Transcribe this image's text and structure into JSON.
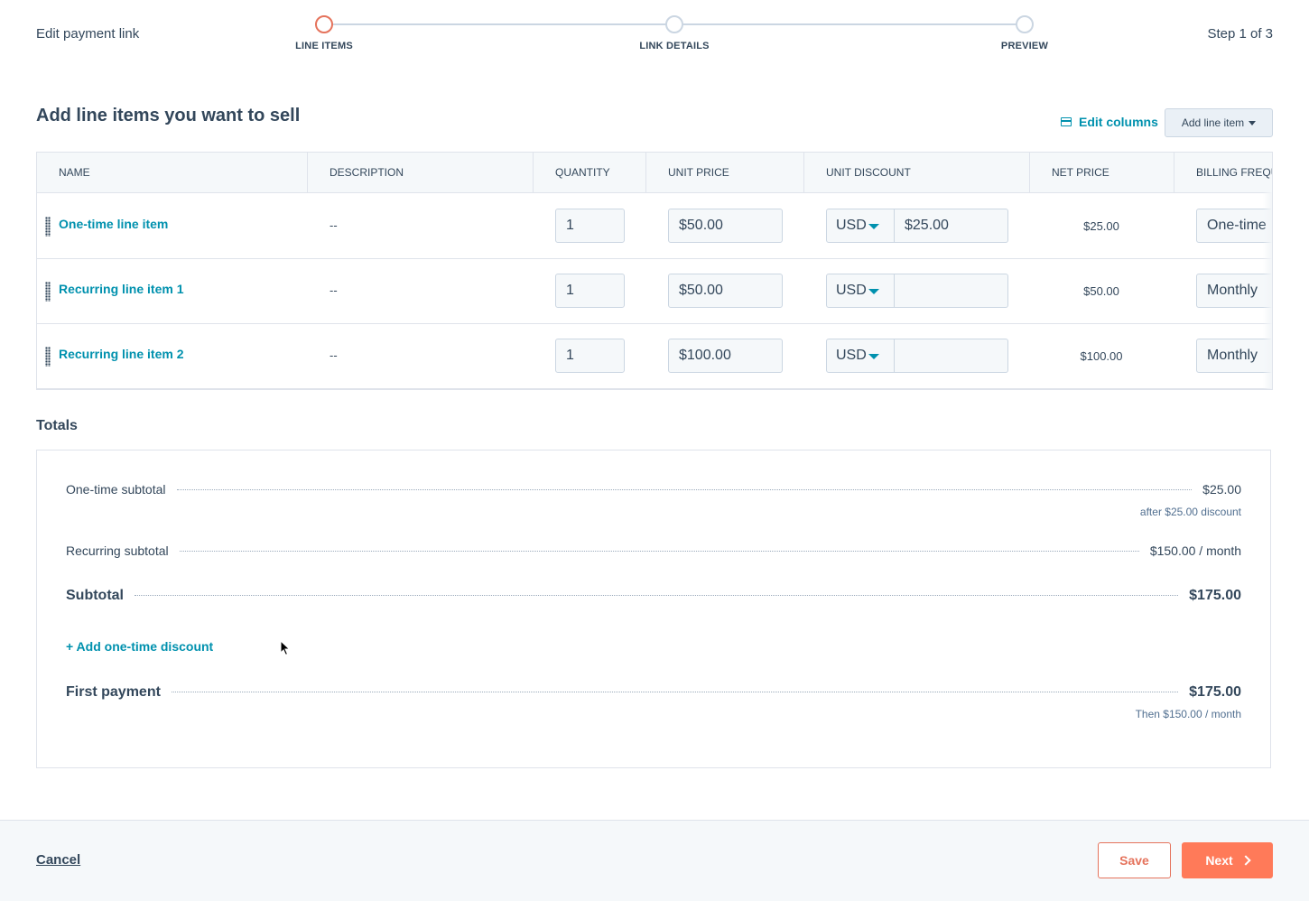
{
  "header": {
    "title": "Edit payment link",
    "step_count": "Step 1 of 3",
    "steps": [
      {
        "label": "LINE ITEMS",
        "active": true
      },
      {
        "label": "LINK DETAILS",
        "active": false
      },
      {
        "label": "PREVIEW",
        "active": false
      }
    ]
  },
  "section": {
    "title": "Add line items you want to sell",
    "edit_columns": "Edit columns",
    "add_line_item": "Add line item"
  },
  "table": {
    "columns": [
      "NAME",
      "DESCRIPTION",
      "QUANTITY",
      "UNIT PRICE",
      "UNIT DISCOUNT",
      "NET PRICE",
      "BILLING FREQUENCY"
    ],
    "rows": [
      {
        "name": "One-time line item",
        "description": "--",
        "quantity": "1",
        "unit_price": "$50.00",
        "currency": "USD",
        "discount": "$25.00",
        "net_price": "$25.00",
        "billing": "One-time"
      },
      {
        "name": "Recurring line item 1",
        "description": "--",
        "quantity": "1",
        "unit_price": "$50.00",
        "currency": "USD",
        "discount": "",
        "net_price": "$50.00",
        "billing": "Monthly"
      },
      {
        "name": "Recurring line item 2",
        "description": "--",
        "quantity": "1",
        "unit_price": "$100.00",
        "currency": "USD",
        "discount": "",
        "net_price": "$100.00",
        "billing": "Monthly"
      }
    ]
  },
  "totals": {
    "title": "Totals",
    "one_time_label": "One-time subtotal",
    "one_time_value": "$25.00",
    "one_time_note": "after $25.00 discount",
    "recurring_label": "Recurring subtotal",
    "recurring_value": "$150.00 / month",
    "subtotal_label": "Subtotal",
    "subtotal_value": "$175.00",
    "add_discount": "+ Add one-time discount",
    "first_payment_label": "First payment",
    "first_payment_value": "$175.00",
    "first_payment_note": "Then $150.00 / month"
  },
  "footer": {
    "cancel": "Cancel",
    "save": "Save",
    "next": "Next"
  },
  "colors": {
    "accent": "#ff7a59",
    "link": "#0091ae",
    "text": "#33475b"
  }
}
